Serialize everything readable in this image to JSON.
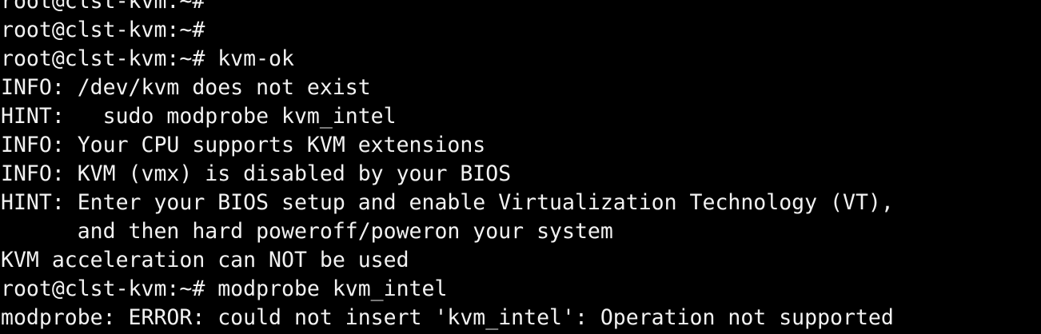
{
  "terminal": {
    "background": "#000000",
    "foreground": "#f2f2f2",
    "lines": [
      "root@clst-kvm:~#",
      "root@clst-kvm:~#",
      "root@clst-kvm:~# kvm-ok",
      "INFO: /dev/kvm does not exist",
      "HINT:   sudo modprobe kvm_intel",
      "INFO: Your CPU supports KVM extensions",
      "INFO: KVM (vmx) is disabled by your BIOS",
      "HINT: Enter your BIOS setup and enable Virtualization Technology (VT),",
      "      and then hard poweroff/poweron your system",
      "KVM acceleration can NOT be used",
      "root@clst-kvm:~# modprobe kvm_intel",
      "modprobe: ERROR: could not insert 'kvm_intel': Operation not supported"
    ]
  }
}
